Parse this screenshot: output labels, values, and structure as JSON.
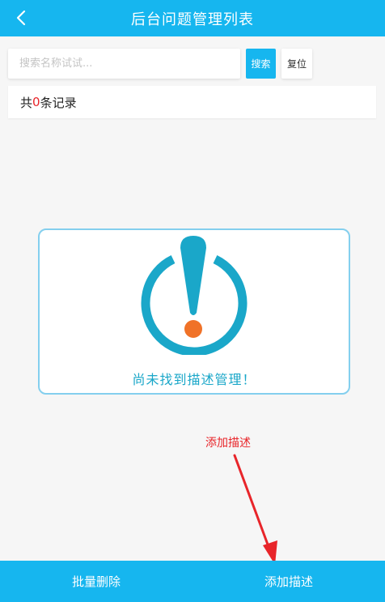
{
  "header": {
    "title": "后台问题管理列表",
    "back_icon": "chevron-left-icon"
  },
  "search": {
    "placeholder": "搜索名称试试...",
    "value": "",
    "search_label": "搜索",
    "reset_label": "复位"
  },
  "records": {
    "prefix": "共",
    "count": "0",
    "suffix": "条记录"
  },
  "empty_state": {
    "icon": "exclamation-alert-icon",
    "message": "尚未找到描述管理！"
  },
  "annotation": {
    "label": "添加描述"
  },
  "footer": {
    "batch_delete_label": "批量删除",
    "add_description_label": "添加描述"
  },
  "colors": {
    "primary": "#16b6ef",
    "accent_red": "#e8252a",
    "icon_teal": "#1aa7c9",
    "icon_orange": "#f07228",
    "card_border": "#84cfee",
    "background": "#f6f6f6"
  }
}
